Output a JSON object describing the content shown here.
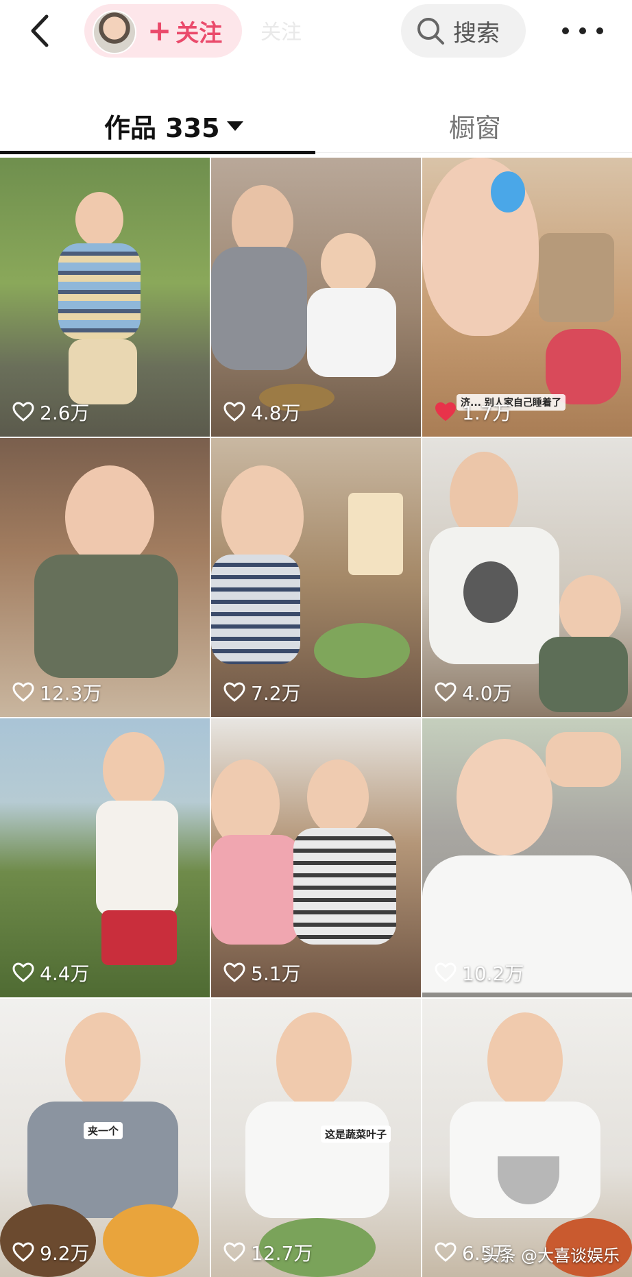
{
  "header": {
    "follow_label": "关注",
    "search_label": "搜索",
    "faint_title": "关注"
  },
  "tabs": {
    "works_label": "作品 335",
    "window_label": "橱窗"
  },
  "videos": [
    {
      "likes": "2.6万"
    },
    {
      "likes": "4.8万"
    },
    {
      "likes": "1.7万",
      "caption": "济... 别人家自己睡着了"
    },
    {
      "likes": "12.3万"
    },
    {
      "likes": "7.2万"
    },
    {
      "likes": "4.0万"
    },
    {
      "likes": "4.4万"
    },
    {
      "likes": "5.1万"
    },
    {
      "likes": "10.2万"
    },
    {
      "likes": "9.2万",
      "caption": "夹一个"
    },
    {
      "likes": "12.7万",
      "caption": "这是蔬菜叶子"
    },
    {
      "likes": "6.5万"
    }
  ],
  "watermark": "头条 @大喜谈娱乐",
  "colors": {
    "accent": "#ea4a6b",
    "follow_bg": "#fde6ea",
    "liked_heart": "#e8334a"
  }
}
